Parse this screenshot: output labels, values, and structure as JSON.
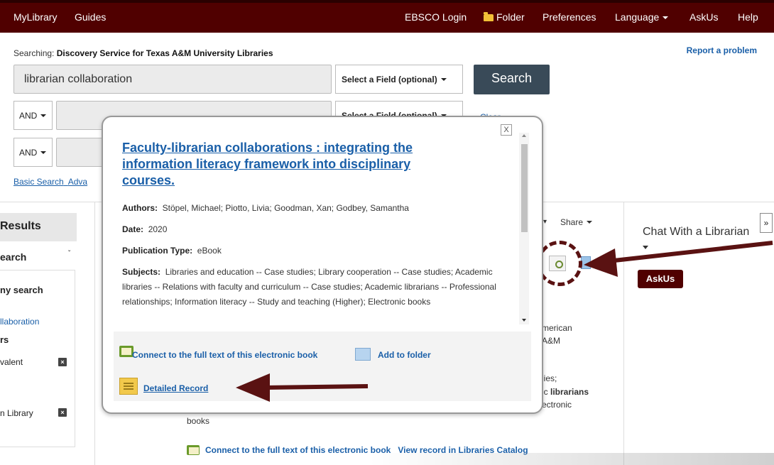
{
  "topnav": {
    "left": [
      "MyLibrary",
      "Guides"
    ],
    "ebsco_login": "EBSCO Login",
    "folder": "Folder",
    "preferences": "Preferences",
    "language": "Language",
    "askus": "AskUs",
    "help": "Help"
  },
  "search": {
    "searching_label": "Searching:",
    "searching_target": "Discovery Service for Texas A&M University Libraries",
    "report_problem": "Report a problem",
    "query": "librarian collaboration",
    "field_select": "Select a Field (optional)",
    "search_button": "Search",
    "bool_op": "AND",
    "clear": "Clear",
    "basic_search": "Basic Search",
    "advanced_partial": "Adva"
  },
  "left": {
    "results": "Results",
    "search_label": "earch",
    "my_search": "ny search",
    "collab": "llaboration",
    "rs": "rs",
    "valent": "valent",
    "library": "n Library"
  },
  "results_bg": {
    "share": "Share",
    "merican": "merican",
    "am": "A&M",
    "ies": "lies;",
    "ic_librarians_pre": "ic ",
    "ic_librarians_bold": "librarians",
    "ectronic": "ectronic",
    "books": "books",
    "connect_link": "Connect to the full text of this electronic book",
    "view_catalog": "View record in Libraries Catalog"
  },
  "chat": {
    "title": "Chat With a Librarian",
    "askus_button": "AskUs",
    "expand": "»"
  },
  "popup": {
    "close": "X",
    "title": "Faculty-librarian collaborations : integrating the information literacy framework into disciplinary courses.",
    "authors_label": "Authors:",
    "authors": "Stöpel, Michael; Piotto, Livia; Goodman, Xan; Godbey, Samantha",
    "date_label": "Date:",
    "date": "2020",
    "pubtype_label": "Publication Type:",
    "pubtype": "eBook",
    "subjects_label": "Subjects:",
    "subjects": "Libraries and education -- Case studies; Library cooperation -- Case studies; Academic libraries -- Relations with faculty and curriculum -- Case studies; Academic librarians -- Professional relationships; Information literacy -- Study and teaching (Higher); Electronic books",
    "connect": "Connect to the full text of this electronic book",
    "add_to_folder": "Add to folder",
    "detailed_record": "Detailed Record"
  },
  "colors": {
    "brand_maroon": "#500000",
    "link_blue": "#1a5fa8",
    "search_button": "#394a58"
  }
}
